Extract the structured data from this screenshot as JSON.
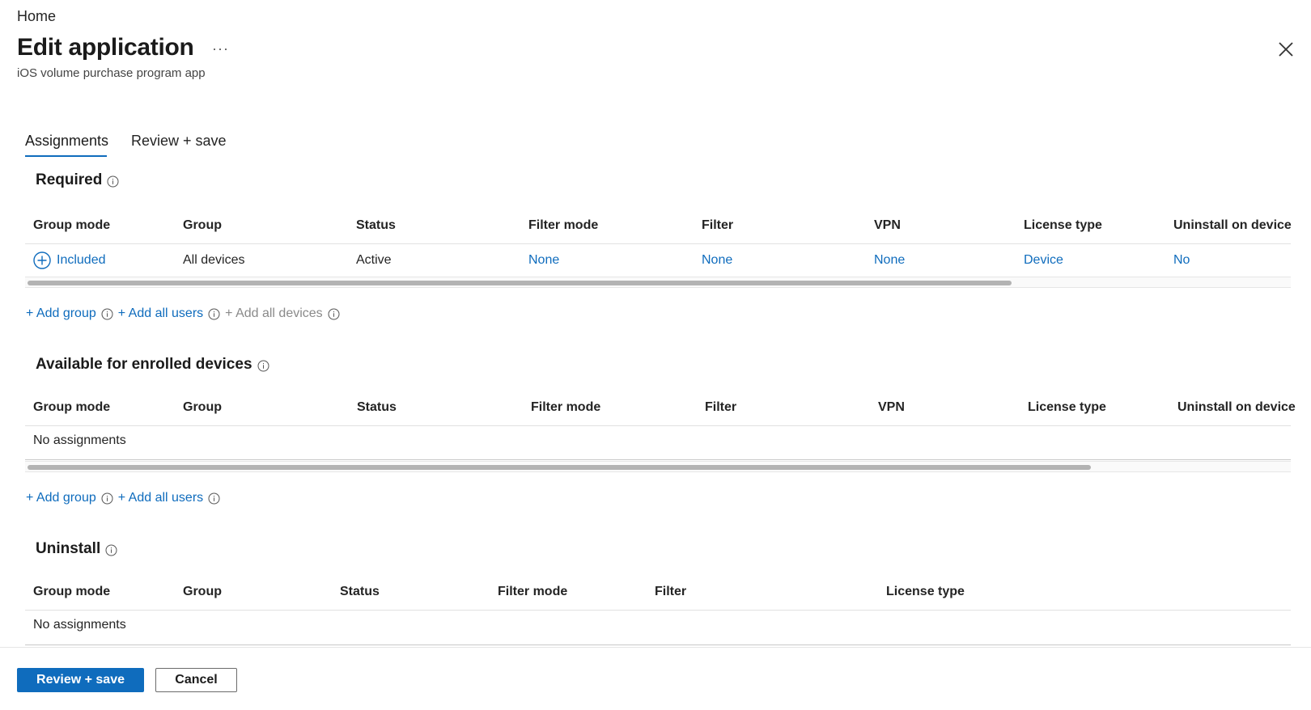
{
  "breadcrumb": "Home",
  "page": {
    "title": "Edit application",
    "more_label": "···",
    "subtitle": "iOS volume purchase program app"
  },
  "tabs": [
    {
      "label": "Assignments",
      "active": true
    },
    {
      "label": "Review + save",
      "active": false
    }
  ],
  "required": {
    "title": "Required",
    "columns": [
      "Group mode",
      "Group",
      "Status",
      "Filter mode",
      "Filter",
      "VPN",
      "License type",
      "Uninstall on device"
    ],
    "rows": [
      {
        "group_mode": "Included",
        "group": "All devices",
        "status": "Active",
        "filter_mode": "None",
        "filter": "None",
        "vpn": "None",
        "license_type": "Device",
        "uninstall": "No"
      }
    ],
    "actions": {
      "add_group": "+ Add group",
      "add_all_users": "+ Add all users",
      "add_all_devices": "+ Add all devices"
    }
  },
  "available": {
    "title": "Available for enrolled devices",
    "columns": [
      "Group mode",
      "Group",
      "Status",
      "Filter mode",
      "Filter",
      "VPN",
      "License type",
      "Uninstall on device"
    ],
    "empty_text": "No assignments",
    "actions": {
      "add_group": "+ Add group",
      "add_all_users": "+ Add all users"
    }
  },
  "uninstall": {
    "title": "Uninstall",
    "columns": [
      "Group mode",
      "Group",
      "Status",
      "Filter mode",
      "Filter",
      "License type"
    ],
    "empty_text": "No assignments"
  },
  "footer": {
    "primary_label": "Review + save",
    "cancel_label": "Cancel"
  },
  "colors": {
    "accent": "#0f6cbd",
    "text": "#242424",
    "disabled": "#8a8a8a"
  }
}
